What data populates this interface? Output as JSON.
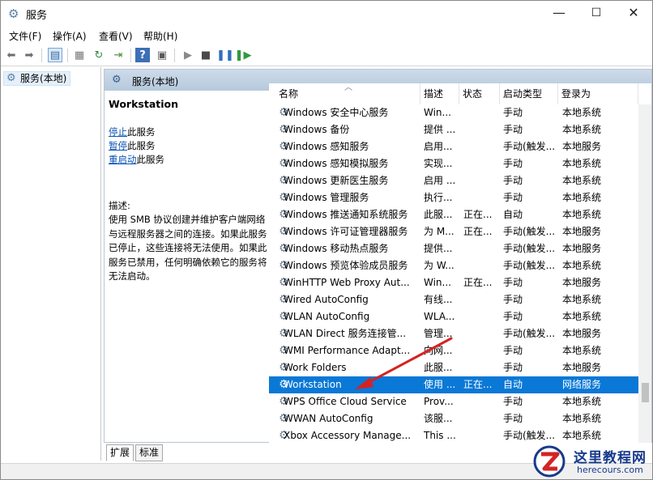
{
  "window": {
    "title": "服务",
    "minimize": "—",
    "maximize": "☐",
    "close": "✕"
  },
  "menu": [
    "文件(F)",
    "操作(A)",
    "查看(V)",
    "帮助(H)"
  ],
  "tree": {
    "root_label": "服务(本地)"
  },
  "pane": {
    "header_title": "服务(本地)",
    "desc_title": "Workstation",
    "actions": [
      {
        "link": "停止",
        "rest": "此服务"
      },
      {
        "link": "暂停",
        "rest": "此服务"
      },
      {
        "link": "重启动",
        "rest": "此服务"
      }
    ],
    "desc_label": "描述:",
    "desc_text": "使用 SMB 协议创建并维护客户端网络与远程服务器之间的连接。如果此服务已停止，这些连接将无法使用。如果此服务已禁用，任何明确依赖它的服务将无法启动。"
  },
  "columns": [
    "名称",
    "描述",
    "状态",
    "启动类型",
    "登录为"
  ],
  "services": [
    {
      "name": "Windows 安全中心服务",
      "desc": "Win...",
      "status": "",
      "startup": "手动",
      "logon": "本地系统"
    },
    {
      "name": "Windows 备份",
      "desc": "提供 ...",
      "status": "",
      "startup": "手动",
      "logon": "本地系统"
    },
    {
      "name": "Windows 感知服务",
      "desc": "启用...",
      "status": "",
      "startup": "手动(触发...",
      "logon": "本地服务"
    },
    {
      "name": "Windows 感知模拟服务",
      "desc": "实现...",
      "status": "",
      "startup": "手动",
      "logon": "本地系统"
    },
    {
      "name": "Windows 更新医生服务",
      "desc": "启用 ...",
      "status": "",
      "startup": "手动",
      "logon": "本地系统"
    },
    {
      "name": "Windows 管理服务",
      "desc": "执行...",
      "status": "",
      "startup": "手动",
      "logon": "本地系统"
    },
    {
      "name": "Windows 推送通知系统服务",
      "desc": "此服...",
      "status": "正在...",
      "startup": "自动",
      "logon": "本地系统"
    },
    {
      "name": "Windows 许可证管理器服务",
      "desc": "为 M...",
      "status": "正在...",
      "startup": "手动(触发...",
      "logon": "本地服务"
    },
    {
      "name": "Windows 移动热点服务",
      "desc": "提供...",
      "status": "",
      "startup": "手动(触发...",
      "logon": "本地服务"
    },
    {
      "name": "Windows 预览体验成员服务",
      "desc": "为 W...",
      "status": "",
      "startup": "手动(触发...",
      "logon": "本地系统"
    },
    {
      "name": "WinHTTP Web Proxy Aut...",
      "desc": "Win...",
      "status": "正在...",
      "startup": "手动",
      "logon": "本地服务"
    },
    {
      "name": "Wired AutoConfig",
      "desc": "有线...",
      "status": "",
      "startup": "手动",
      "logon": "本地系统"
    },
    {
      "name": "WLAN AutoConfig",
      "desc": "WLA...",
      "status": "",
      "startup": "手动",
      "logon": "本地系统"
    },
    {
      "name": "WLAN Direct 服务连接管...",
      "desc": "管理...",
      "status": "",
      "startup": "手动(触发...",
      "logon": "本地服务"
    },
    {
      "name": "WMI Performance Adapt...",
      "desc": "向网...",
      "status": "",
      "startup": "手动",
      "logon": "本地系统"
    },
    {
      "name": "Work Folders",
      "desc": "此服...",
      "status": "",
      "startup": "手动",
      "logon": "本地服务"
    },
    {
      "name": "Workstation",
      "desc": "使用 ...",
      "status": "正在...",
      "startup": "自动",
      "logon": "网络服务"
    },
    {
      "name": "WPS Office Cloud Service",
      "desc": "Prov...",
      "status": "",
      "startup": "手动",
      "logon": "本地系统"
    },
    {
      "name": "WWAN AutoConfig",
      "desc": "该服...",
      "status": "",
      "startup": "手动",
      "logon": "本地系统"
    },
    {
      "name": "Xbox Accessory Manage...",
      "desc": "This ...",
      "status": "",
      "startup": "手动(触发...",
      "logon": "本地系统"
    }
  ],
  "selected_index": 16,
  "tabs": [
    "扩展",
    "标准"
  ],
  "watermark": {
    "title": "这里教程网",
    "url": "herecours.com"
  },
  "colors": {
    "selection": "#0a78d6",
    "arrow": "#d42323",
    "header": "#c3d4e6"
  }
}
